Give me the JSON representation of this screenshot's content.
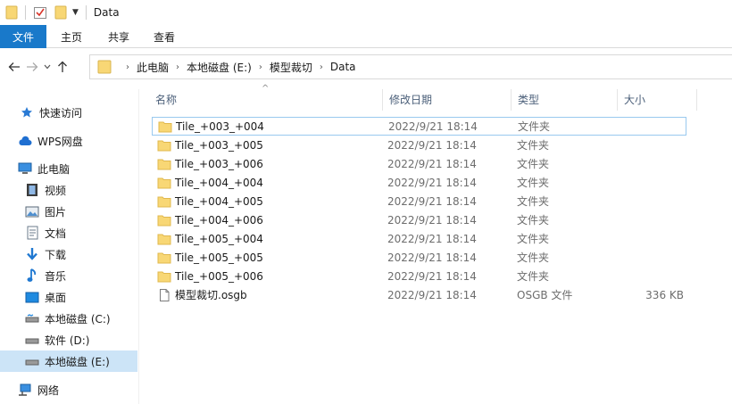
{
  "window": {
    "title": "Data"
  },
  "ribbon": {
    "tabs": [
      "文件",
      "主页",
      "共享",
      "查看"
    ]
  },
  "address": {
    "crumbs": [
      "此电脑",
      "本地磁盘 (E:)",
      "模型裁切",
      "Data"
    ]
  },
  "nav": {
    "items": [
      {
        "label": "快速访问",
        "icon": "star-icon",
        "level": 0
      },
      {
        "label": "WPS网盘",
        "icon": "cloud-icon",
        "level": 0
      },
      {
        "label": "此电脑",
        "icon": "computer-icon",
        "level": 0
      },
      {
        "label": "视频",
        "icon": "video-icon",
        "level": 1
      },
      {
        "label": "图片",
        "icon": "picture-icon",
        "level": 1
      },
      {
        "label": "文档",
        "icon": "document-icon",
        "level": 1
      },
      {
        "label": "下载",
        "icon": "download-icon",
        "level": 1
      },
      {
        "label": "音乐",
        "icon": "music-icon",
        "level": 1
      },
      {
        "label": "桌面",
        "icon": "desktop-icon",
        "level": 1
      },
      {
        "label": "本地磁盘 (C:)",
        "icon": "drive-icon",
        "level": 1
      },
      {
        "label": "软件 (D:)",
        "icon": "drive-icon",
        "level": 1
      },
      {
        "label": "本地磁盘 (E:)",
        "icon": "drive-icon",
        "level": 1,
        "selected": true
      },
      {
        "label": "网络",
        "icon": "network-icon",
        "level": 0
      }
    ]
  },
  "columns": {
    "name": "名称",
    "date": "修改日期",
    "type": "类型",
    "size": "大小"
  },
  "files": [
    {
      "name": "Tile_+003_+004",
      "date": "2022/9/21 18:14",
      "type": "文件夹",
      "size": "",
      "icon": "folder-icon"
    },
    {
      "name": "Tile_+003_+005",
      "date": "2022/9/21 18:14",
      "type": "文件夹",
      "size": "",
      "icon": "folder-icon"
    },
    {
      "name": "Tile_+003_+006",
      "date": "2022/9/21 18:14",
      "type": "文件夹",
      "size": "",
      "icon": "folder-icon"
    },
    {
      "name": "Tile_+004_+004",
      "date": "2022/9/21 18:14",
      "type": "文件夹",
      "size": "",
      "icon": "folder-icon"
    },
    {
      "name": "Tile_+004_+005",
      "date": "2022/9/21 18:14",
      "type": "文件夹",
      "size": "",
      "icon": "folder-icon"
    },
    {
      "name": "Tile_+004_+006",
      "date": "2022/9/21 18:14",
      "type": "文件夹",
      "size": "",
      "icon": "folder-icon"
    },
    {
      "name": "Tile_+005_+004",
      "date": "2022/9/21 18:14",
      "type": "文件夹",
      "size": "",
      "icon": "folder-icon"
    },
    {
      "name": "Tile_+005_+005",
      "date": "2022/9/21 18:14",
      "type": "文件夹",
      "size": "",
      "icon": "folder-icon"
    },
    {
      "name": "Tile_+005_+006",
      "date": "2022/9/21 18:14",
      "type": "文件夹",
      "size": "",
      "icon": "folder-icon"
    },
    {
      "name": "模型裁切.osgb",
      "date": "2022/9/21 18:14",
      "type": "OSGB 文件",
      "size": "336 KB",
      "icon": "file-icon"
    }
  ],
  "colors": {
    "accent": "#1979ca",
    "selection": "#cce4f7",
    "folder": "#f8d775",
    "header_text": "#4c607a"
  }
}
